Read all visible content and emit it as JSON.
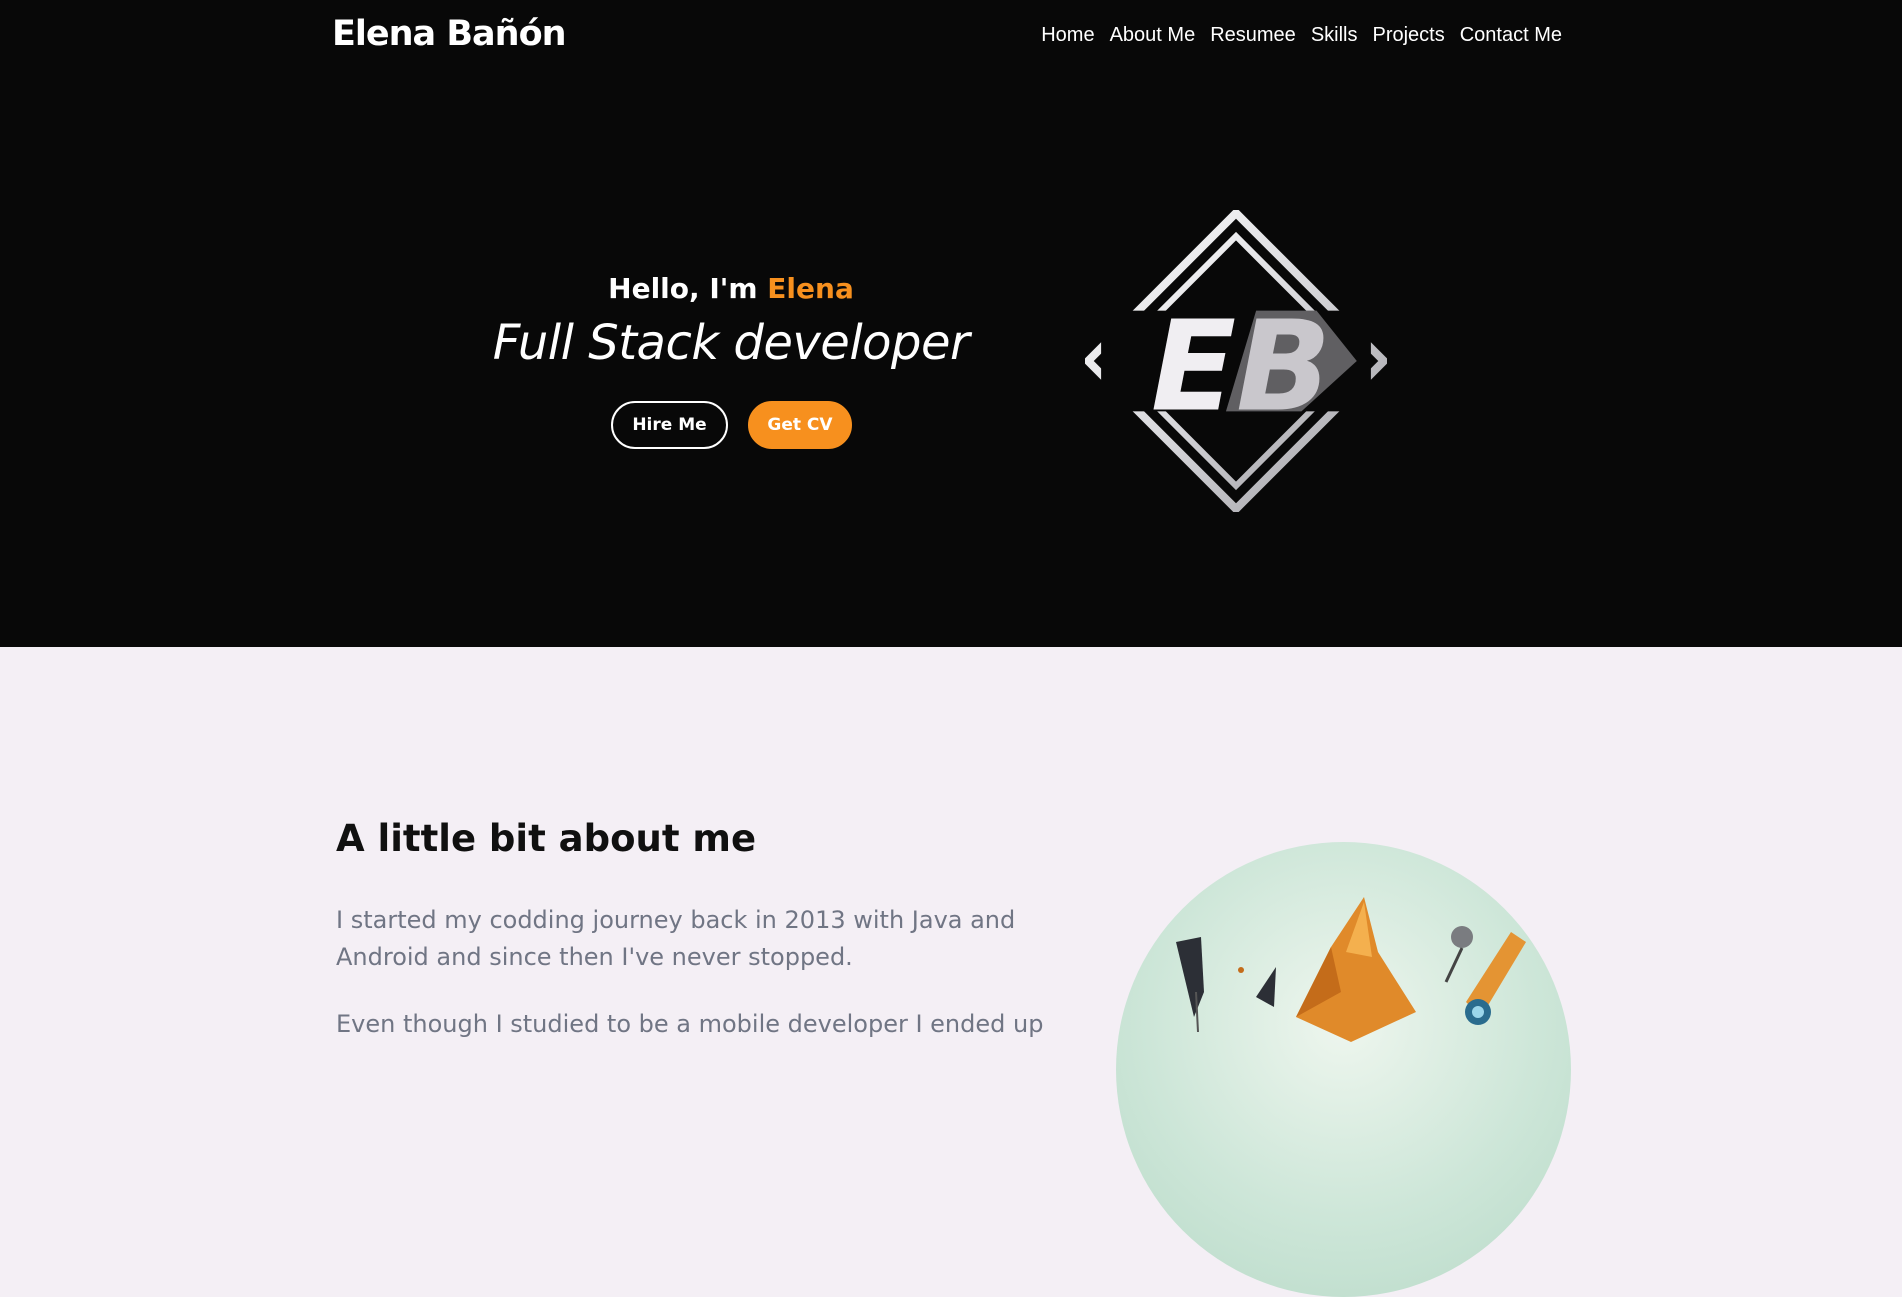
{
  "brand": {
    "name": "Elena Bañón"
  },
  "nav": {
    "items": [
      "Home",
      "About Me",
      "Resumee",
      "Skills",
      "Projects",
      "Contact Me"
    ]
  },
  "hero": {
    "greeting_prefix": "Hello, I'm ",
    "greeting_name": "Elena",
    "role": "Full Stack developer",
    "hire_label": "Hire Me",
    "cv_label": "Get CV",
    "logo_monogram": "EB"
  },
  "about": {
    "title": "A little bit about me",
    "paragraph1": "I started my codding journey back in 2013 with Java and Android and since then I've never stopped.",
    "paragraph2": "Even though I studied to be a mobile developer I ended up"
  },
  "colors": {
    "accent": "#f7901e",
    "hero_bg": "#080808",
    "page_bg": "#f4eff5"
  },
  "icons": {
    "logo": "eb-diamond-logo-icon",
    "avatar": "robot-illustration-avatar"
  }
}
